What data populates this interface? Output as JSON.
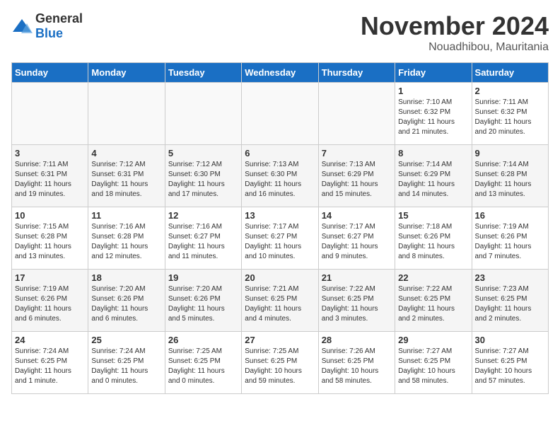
{
  "logo": {
    "text_general": "General",
    "text_blue": "Blue"
  },
  "header": {
    "month": "November 2024",
    "location": "Nouadhibou, Mauritania"
  },
  "days_of_week": [
    "Sunday",
    "Monday",
    "Tuesday",
    "Wednesday",
    "Thursday",
    "Friday",
    "Saturday"
  ],
  "weeks": [
    [
      {
        "day": "",
        "info": ""
      },
      {
        "day": "",
        "info": ""
      },
      {
        "day": "",
        "info": ""
      },
      {
        "day": "",
        "info": ""
      },
      {
        "day": "",
        "info": ""
      },
      {
        "day": "1",
        "info": "Sunrise: 7:10 AM\nSunset: 6:32 PM\nDaylight: 11 hours\nand 21 minutes."
      },
      {
        "day": "2",
        "info": "Sunrise: 7:11 AM\nSunset: 6:32 PM\nDaylight: 11 hours\nand 20 minutes."
      }
    ],
    [
      {
        "day": "3",
        "info": "Sunrise: 7:11 AM\nSunset: 6:31 PM\nDaylight: 11 hours\nand 19 minutes."
      },
      {
        "day": "4",
        "info": "Sunrise: 7:12 AM\nSunset: 6:31 PM\nDaylight: 11 hours\nand 18 minutes."
      },
      {
        "day": "5",
        "info": "Sunrise: 7:12 AM\nSunset: 6:30 PM\nDaylight: 11 hours\nand 17 minutes."
      },
      {
        "day": "6",
        "info": "Sunrise: 7:13 AM\nSunset: 6:30 PM\nDaylight: 11 hours\nand 16 minutes."
      },
      {
        "day": "7",
        "info": "Sunrise: 7:13 AM\nSunset: 6:29 PM\nDaylight: 11 hours\nand 15 minutes."
      },
      {
        "day": "8",
        "info": "Sunrise: 7:14 AM\nSunset: 6:29 PM\nDaylight: 11 hours\nand 14 minutes."
      },
      {
        "day": "9",
        "info": "Sunrise: 7:14 AM\nSunset: 6:28 PM\nDaylight: 11 hours\nand 13 minutes."
      }
    ],
    [
      {
        "day": "10",
        "info": "Sunrise: 7:15 AM\nSunset: 6:28 PM\nDaylight: 11 hours\nand 13 minutes."
      },
      {
        "day": "11",
        "info": "Sunrise: 7:16 AM\nSunset: 6:28 PM\nDaylight: 11 hours\nand 12 minutes."
      },
      {
        "day": "12",
        "info": "Sunrise: 7:16 AM\nSunset: 6:27 PM\nDaylight: 11 hours\nand 11 minutes."
      },
      {
        "day": "13",
        "info": "Sunrise: 7:17 AM\nSunset: 6:27 PM\nDaylight: 11 hours\nand 10 minutes."
      },
      {
        "day": "14",
        "info": "Sunrise: 7:17 AM\nSunset: 6:27 PM\nDaylight: 11 hours\nand 9 minutes."
      },
      {
        "day": "15",
        "info": "Sunrise: 7:18 AM\nSunset: 6:26 PM\nDaylight: 11 hours\nand 8 minutes."
      },
      {
        "day": "16",
        "info": "Sunrise: 7:19 AM\nSunset: 6:26 PM\nDaylight: 11 hours\nand 7 minutes."
      }
    ],
    [
      {
        "day": "17",
        "info": "Sunrise: 7:19 AM\nSunset: 6:26 PM\nDaylight: 11 hours\nand 6 minutes."
      },
      {
        "day": "18",
        "info": "Sunrise: 7:20 AM\nSunset: 6:26 PM\nDaylight: 11 hours\nand 6 minutes."
      },
      {
        "day": "19",
        "info": "Sunrise: 7:20 AM\nSunset: 6:26 PM\nDaylight: 11 hours\nand 5 minutes."
      },
      {
        "day": "20",
        "info": "Sunrise: 7:21 AM\nSunset: 6:25 PM\nDaylight: 11 hours\nand 4 minutes."
      },
      {
        "day": "21",
        "info": "Sunrise: 7:22 AM\nSunset: 6:25 PM\nDaylight: 11 hours\nand 3 minutes."
      },
      {
        "day": "22",
        "info": "Sunrise: 7:22 AM\nSunset: 6:25 PM\nDaylight: 11 hours\nand 2 minutes."
      },
      {
        "day": "23",
        "info": "Sunrise: 7:23 AM\nSunset: 6:25 PM\nDaylight: 11 hours\nand 2 minutes."
      }
    ],
    [
      {
        "day": "24",
        "info": "Sunrise: 7:24 AM\nSunset: 6:25 PM\nDaylight: 11 hours\nand 1 minute."
      },
      {
        "day": "25",
        "info": "Sunrise: 7:24 AM\nSunset: 6:25 PM\nDaylight: 11 hours\nand 0 minutes."
      },
      {
        "day": "26",
        "info": "Sunrise: 7:25 AM\nSunset: 6:25 PM\nDaylight: 11 hours\nand 0 minutes."
      },
      {
        "day": "27",
        "info": "Sunrise: 7:25 AM\nSunset: 6:25 PM\nDaylight: 10 hours\nand 59 minutes."
      },
      {
        "day": "28",
        "info": "Sunrise: 7:26 AM\nSunset: 6:25 PM\nDaylight: 10 hours\nand 58 minutes."
      },
      {
        "day": "29",
        "info": "Sunrise: 7:27 AM\nSunset: 6:25 PM\nDaylight: 10 hours\nand 58 minutes."
      },
      {
        "day": "30",
        "info": "Sunrise: 7:27 AM\nSunset: 6:25 PM\nDaylight: 10 hours\nand 57 minutes."
      }
    ]
  ]
}
